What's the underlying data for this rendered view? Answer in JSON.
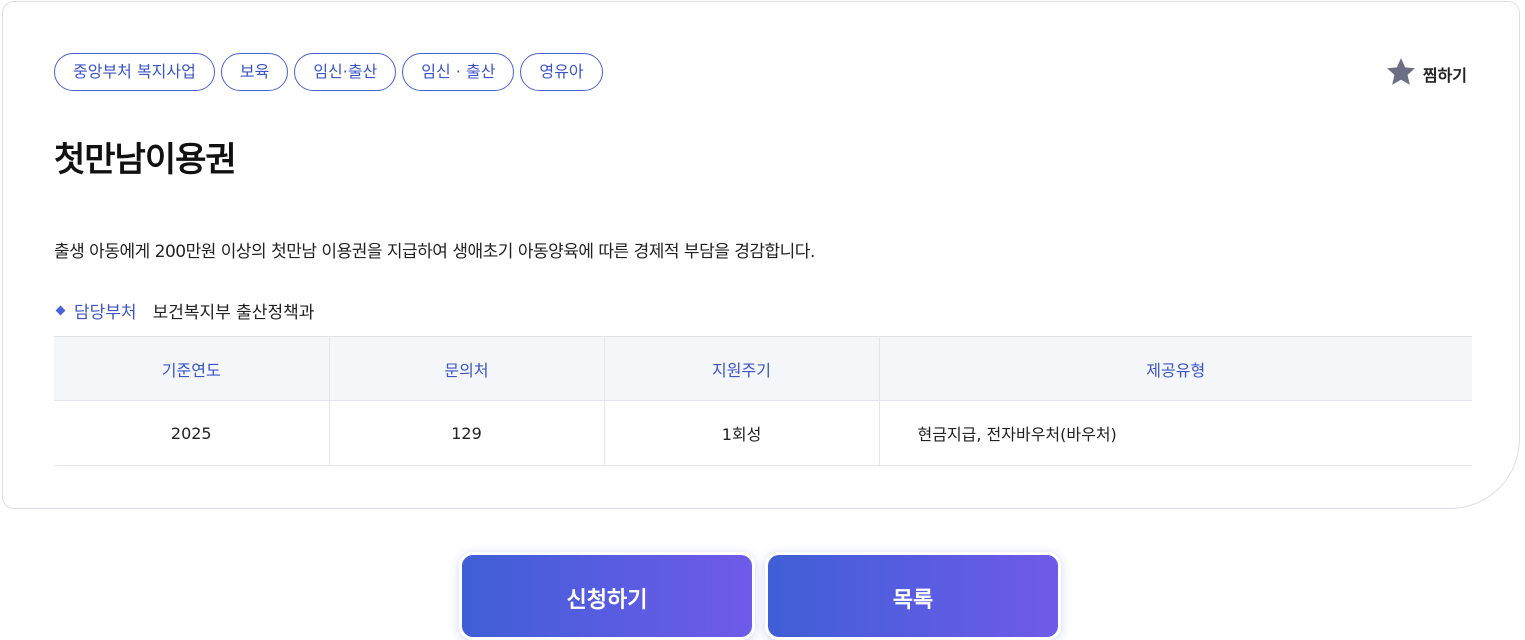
{
  "tags": [
    "중앙부처 복지사업",
    "보육",
    "임신·출산",
    "임신 · 출산",
    "영유아"
  ],
  "favorite": {
    "label": "찜하기",
    "icon": "star-icon",
    "icon_color": "#6b6e85"
  },
  "title": "첫만남이용권",
  "description": "출생 아동에게 200만원 이상의 첫만남 이용권을 지급하여 생애초기 아동양육에 따른 경제적 부담을 경감합니다.",
  "department": {
    "label": "담당부처",
    "value": "보건복지부 출산정책과"
  },
  "info_table": {
    "headers": [
      "기준연도",
      "문의처",
      "지원주기",
      "제공유형"
    ],
    "row": [
      "2025",
      "129",
      "1회성",
      "현금지급, 전자바우처(바우처)"
    ]
  },
  "buttons": {
    "apply": "신청하기",
    "list": "목록"
  },
  "colors": {
    "accent": "#3b55c8",
    "button_gradient_start": "#3f5fd6",
    "button_gradient_end": "#6f5ae9"
  }
}
